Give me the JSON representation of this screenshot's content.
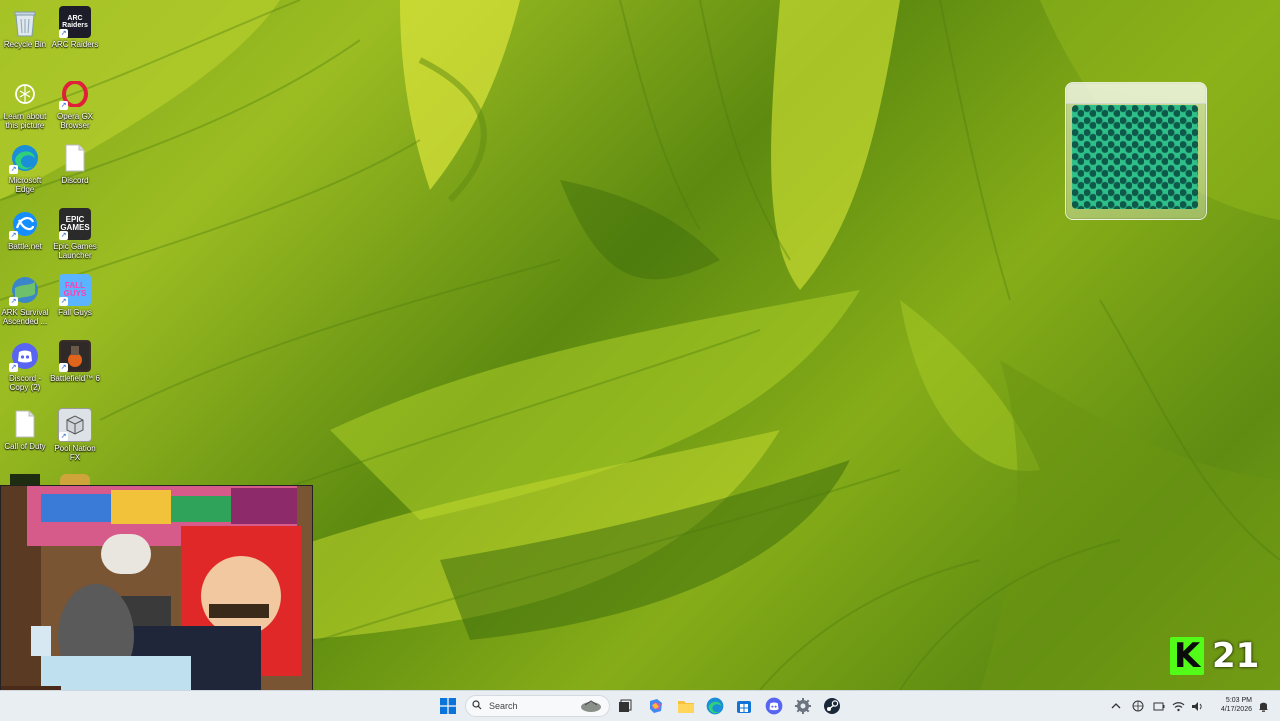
{
  "desktop_icons": [
    {
      "id": "recycle-bin",
      "label": "Recycle Bin",
      "icon": "recycle-bin-icon"
    },
    {
      "id": "arc-raiders",
      "label": "ARC Raiders",
      "icon": "arc-raiders-icon"
    },
    {
      "id": "learn-picture",
      "label": "Learn about this picture",
      "icon": "camera-icon"
    },
    {
      "id": "opera-gx",
      "label": "Opera GX Browser",
      "icon": "opera-gx-icon"
    },
    {
      "id": "edge",
      "label": "Microsoft Edge",
      "icon": "edge-icon"
    },
    {
      "id": "discord-file",
      "label": "Discord",
      "icon": "file-icon"
    },
    {
      "id": "battlenet",
      "label": "Battle.net",
      "icon": "battlenet-icon"
    },
    {
      "id": "epic",
      "label": "Epic Games Launcher",
      "icon": "epic-games-icon"
    },
    {
      "id": "ark",
      "label": "ARK Survival Ascended ...",
      "icon": "ark-icon"
    },
    {
      "id": "fall-guys",
      "label": "Fall Guys",
      "icon": "fall-guys-icon"
    },
    {
      "id": "discord-copy",
      "label": "Discord - Copy (2)",
      "icon": "discord-icon"
    },
    {
      "id": "battlefield",
      "label": "Battlefield™ 6",
      "icon": "battlefield-icon"
    },
    {
      "id": "call-of-duty",
      "label": "Call of Duty",
      "icon": "file-icon"
    },
    {
      "id": "pool-nation",
      "label": "Pool Nation FX",
      "icon": "pool-nation-icon"
    }
  ],
  "icon_text": {
    "arc": "ARC\nRaiders",
    "epic": "EPIC\nGAMES",
    "fall_guys": "FALL\nGUYS"
  },
  "overlay": {
    "k_letter": "K",
    "count": "21",
    "brand_color": "#53fc18"
  },
  "taskbar": {
    "search_placeholder": "Search",
    "pinned": [
      "windows-start-icon",
      "search-icon",
      "task-view-icon",
      "copilot-icon",
      "file-explorer-icon",
      "edge-icon",
      "microsoft-store-icon",
      "discord-icon",
      "settings-icon",
      "steam-icon"
    ],
    "tray": [
      "chevron-up-icon",
      "network-icon",
      "battery-icon",
      "wifi-icon",
      "volume-icon"
    ],
    "time": "5:03 PM",
    "date": "4/17/2026"
  }
}
